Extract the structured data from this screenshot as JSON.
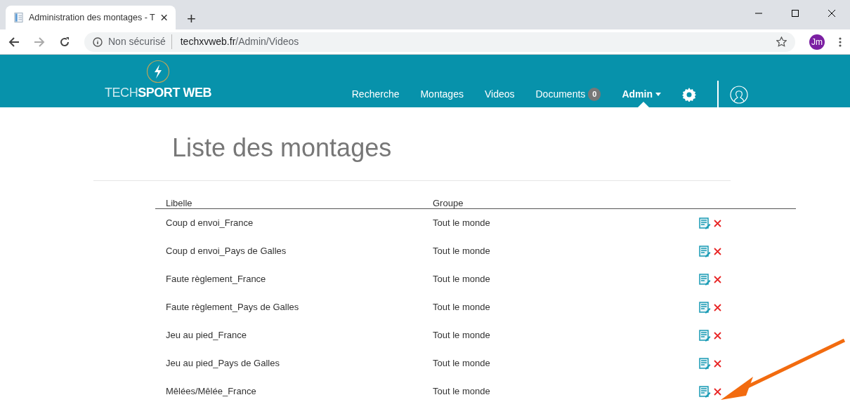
{
  "browser": {
    "tab_title": "Administration des montages - T",
    "new_tab": "+",
    "security": "Non sécurisé",
    "url_host": "techxvweb.fr",
    "url_path": "/Admin/Videos",
    "profile": "Jm"
  },
  "header": {
    "logo_light": "TECH",
    "logo_bold": "SPORT WEB",
    "nav": [
      {
        "label": "Recherche",
        "selected": false
      },
      {
        "label": "Montages",
        "selected": false
      },
      {
        "label": "Videos",
        "selected": false
      },
      {
        "label": "Documents",
        "badge": "0",
        "selected": false
      },
      {
        "label": "Admin",
        "dropdown": true,
        "selected": true
      }
    ]
  },
  "page": {
    "title": "Liste des montages",
    "table": {
      "columns": [
        "Libelle",
        "Groupe"
      ],
      "rows": [
        {
          "libelle": "Coup d envoi_France",
          "groupe": "Tout le monde"
        },
        {
          "libelle": "Coup d envoi_Pays de Galles",
          "groupe": "Tout le monde"
        },
        {
          "libelle": "Faute règlement_France",
          "groupe": "Tout le monde"
        },
        {
          "libelle": "Faute règlement_Pays de Galles",
          "groupe": "Tout le monde"
        },
        {
          "libelle": "Jeu au pied_France",
          "groupe": "Tout le monde"
        },
        {
          "libelle": "Jeu au pied_Pays de Galles",
          "groupe": "Tout le monde"
        },
        {
          "libelle": "Mêlées/Mêlée_France",
          "groupe": "Tout le monde"
        }
      ]
    }
  }
}
